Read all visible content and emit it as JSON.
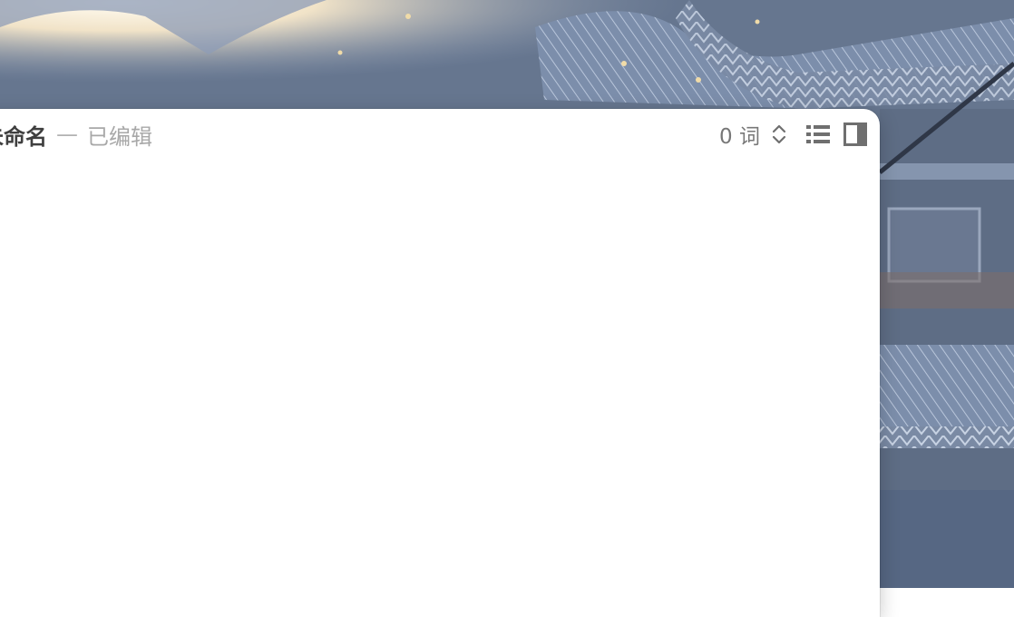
{
  "window": {
    "title": "未命名",
    "separator": "—",
    "status": "已编辑"
  },
  "toolbar": {
    "word_count": "0 词",
    "icons": [
      "chevron-up-down-icon",
      "list-icon",
      "sidebar-panel-icon"
    ]
  },
  "colors": {
    "title_text": "#3f3f3f",
    "status_text": "#a8a8a8",
    "icon": "#6f6f6f",
    "window_bg": "#ffffff"
  }
}
